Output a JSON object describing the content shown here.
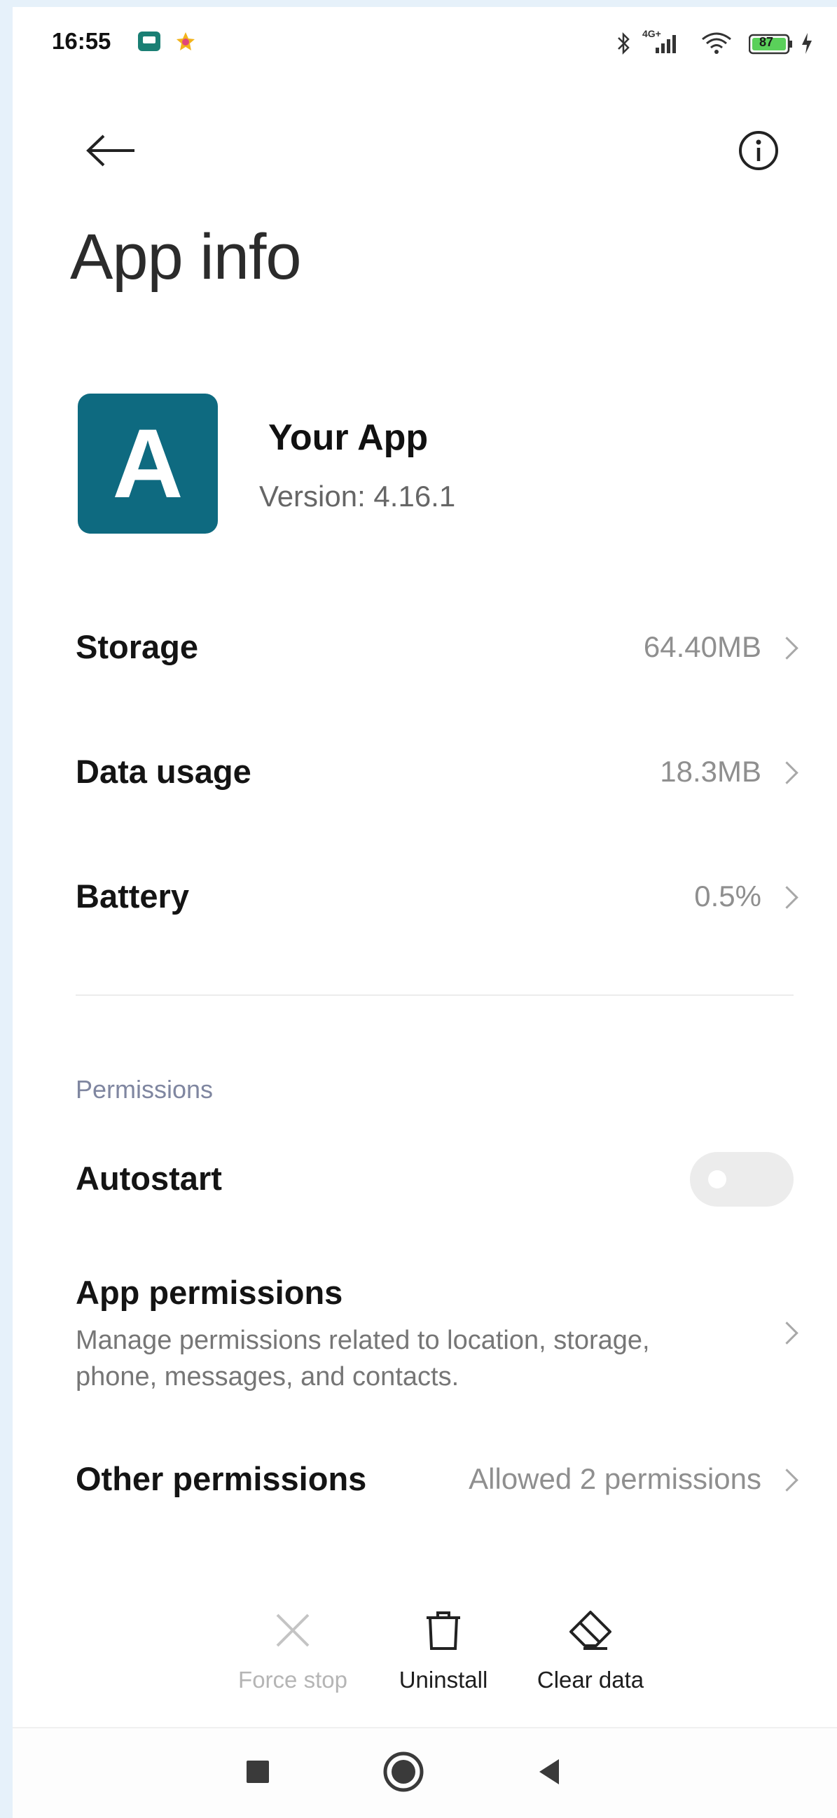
{
  "status_bar": {
    "time": "16:55",
    "network_label": "4G+",
    "battery_level": "87"
  },
  "header": {
    "title": "App info",
    "back_icon": "arrow-left-icon",
    "info_icon": "info-circle-icon"
  },
  "app": {
    "icon_letter": "A",
    "icon_color": "#0e6a80",
    "name": "Your App",
    "version": "Version: 4.16.1"
  },
  "rows": {
    "storage": {
      "label": "Storage",
      "value": "64.40MB"
    },
    "data_usage": {
      "label": "Data usage",
      "value": "18.3MB"
    },
    "battery": {
      "label": "Battery",
      "value": "0.5%"
    }
  },
  "permissions": {
    "section_label": "Permissions",
    "autostart": {
      "label": "Autostart",
      "enabled": false
    },
    "app_permissions": {
      "label": "App permissions",
      "description": "Manage permissions related to location, storage, phone, messages, and contacts."
    },
    "other_permissions": {
      "label": "Other permissions",
      "value": "Allowed 2 permissions"
    }
  },
  "actions": {
    "force_stop": {
      "label": "Force stop",
      "icon": "close-x-icon",
      "enabled": false
    },
    "uninstall": {
      "label": "Uninstall",
      "icon": "trash-icon",
      "enabled": true
    },
    "clear_data": {
      "label": "Clear data",
      "icon": "eraser-icon",
      "enabled": true
    }
  },
  "nav": {
    "recents_icon": "square-icon",
    "home_icon": "circle-icon",
    "back_icon": "triangle-back-icon"
  },
  "colors": {
    "accent": "#0e6a80",
    "muted_text": "#8f8f8f",
    "section_text": "#7f86a0",
    "disabled_text": "#b5b5b5"
  }
}
